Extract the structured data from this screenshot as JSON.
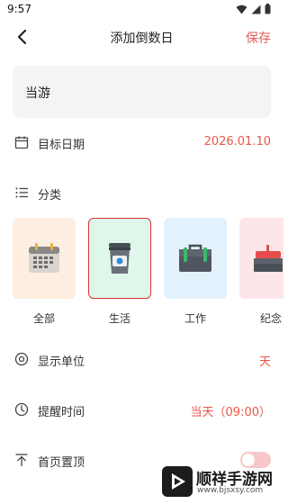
{
  "status_bar": {
    "time": "9:57"
  },
  "nav": {
    "title": "添加倒数日",
    "save_label": "保存"
  },
  "name_field": {
    "value": "当游"
  },
  "target_date": {
    "label": "目标日期",
    "value": "2026.01.10"
  },
  "category": {
    "label": "分类",
    "items": [
      {
        "label": "全部",
        "icon": "calendar-icon",
        "bg": "#fdeee1",
        "selected": false
      },
      {
        "label": "生活",
        "icon": "cup-icon",
        "bg": "#dff6ea",
        "selected": true
      },
      {
        "label": "工作",
        "icon": "briefcase-icon",
        "bg": "#e2f1fb",
        "selected": false
      },
      {
        "label": "纪念",
        "icon": "cake-icon",
        "bg": "#fde6ea",
        "selected": false
      }
    ]
  },
  "display_unit": {
    "label": "显示单位",
    "value": "天"
  },
  "reminder": {
    "label": "提醒时间",
    "value": "当天（09:00）"
  },
  "pin_top": {
    "label": "首页置顶",
    "enabled": false
  },
  "watermark": {
    "text": "顺祥手游网",
    "url": "www.bjsxsy.com"
  },
  "colors": {
    "accent": "#e8564a",
    "selected_border": "#d9363a"
  }
}
